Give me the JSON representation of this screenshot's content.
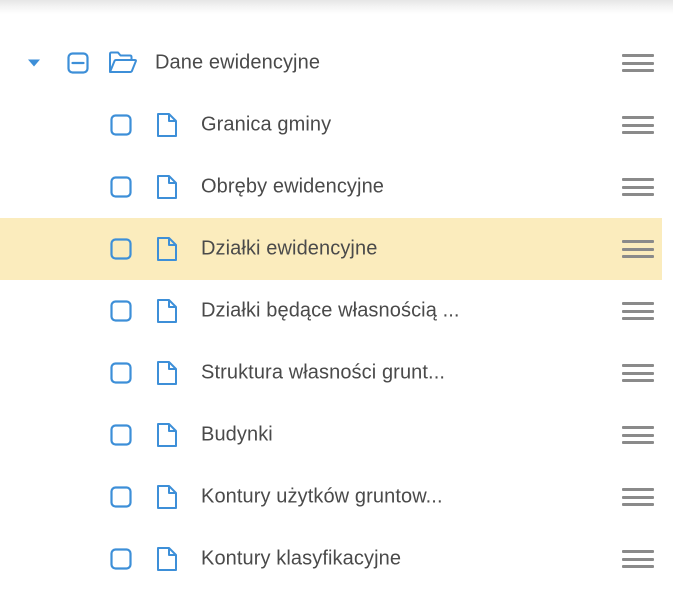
{
  "colors": {
    "accent": "#3d8fd8",
    "selected_bg": "#fbecbd",
    "text": "#4a4a4a",
    "menu_icon": "#8a8a8a"
  },
  "tree": {
    "root": {
      "label": "Dane ewidencyjne",
      "expanded": true,
      "toggle_icon": "caret-down-icon",
      "checkbox_icon": "minus-square-icon",
      "icon": "folder-open-icon",
      "menu_icon": "hamburger-menu-icon"
    },
    "children": [
      {
        "label": "Granica gminy",
        "selected": false
      },
      {
        "label": "Obręby ewidencyjne",
        "selected": false
      },
      {
        "label": "Działki ewidencyjne",
        "selected": true
      },
      {
        "label": "Działki będące własnością ...",
        "selected": false
      },
      {
        "label": "Struktura własności grunt...",
        "selected": false
      },
      {
        "label": "Budynki",
        "selected": false
      },
      {
        "label": "Kontury użytków gruntow...",
        "selected": false
      },
      {
        "label": "Kontury klasyfikacyjne",
        "selected": false
      }
    ],
    "child_icon": "file-icon",
    "child_checkbox_icon": "empty-square-icon"
  }
}
